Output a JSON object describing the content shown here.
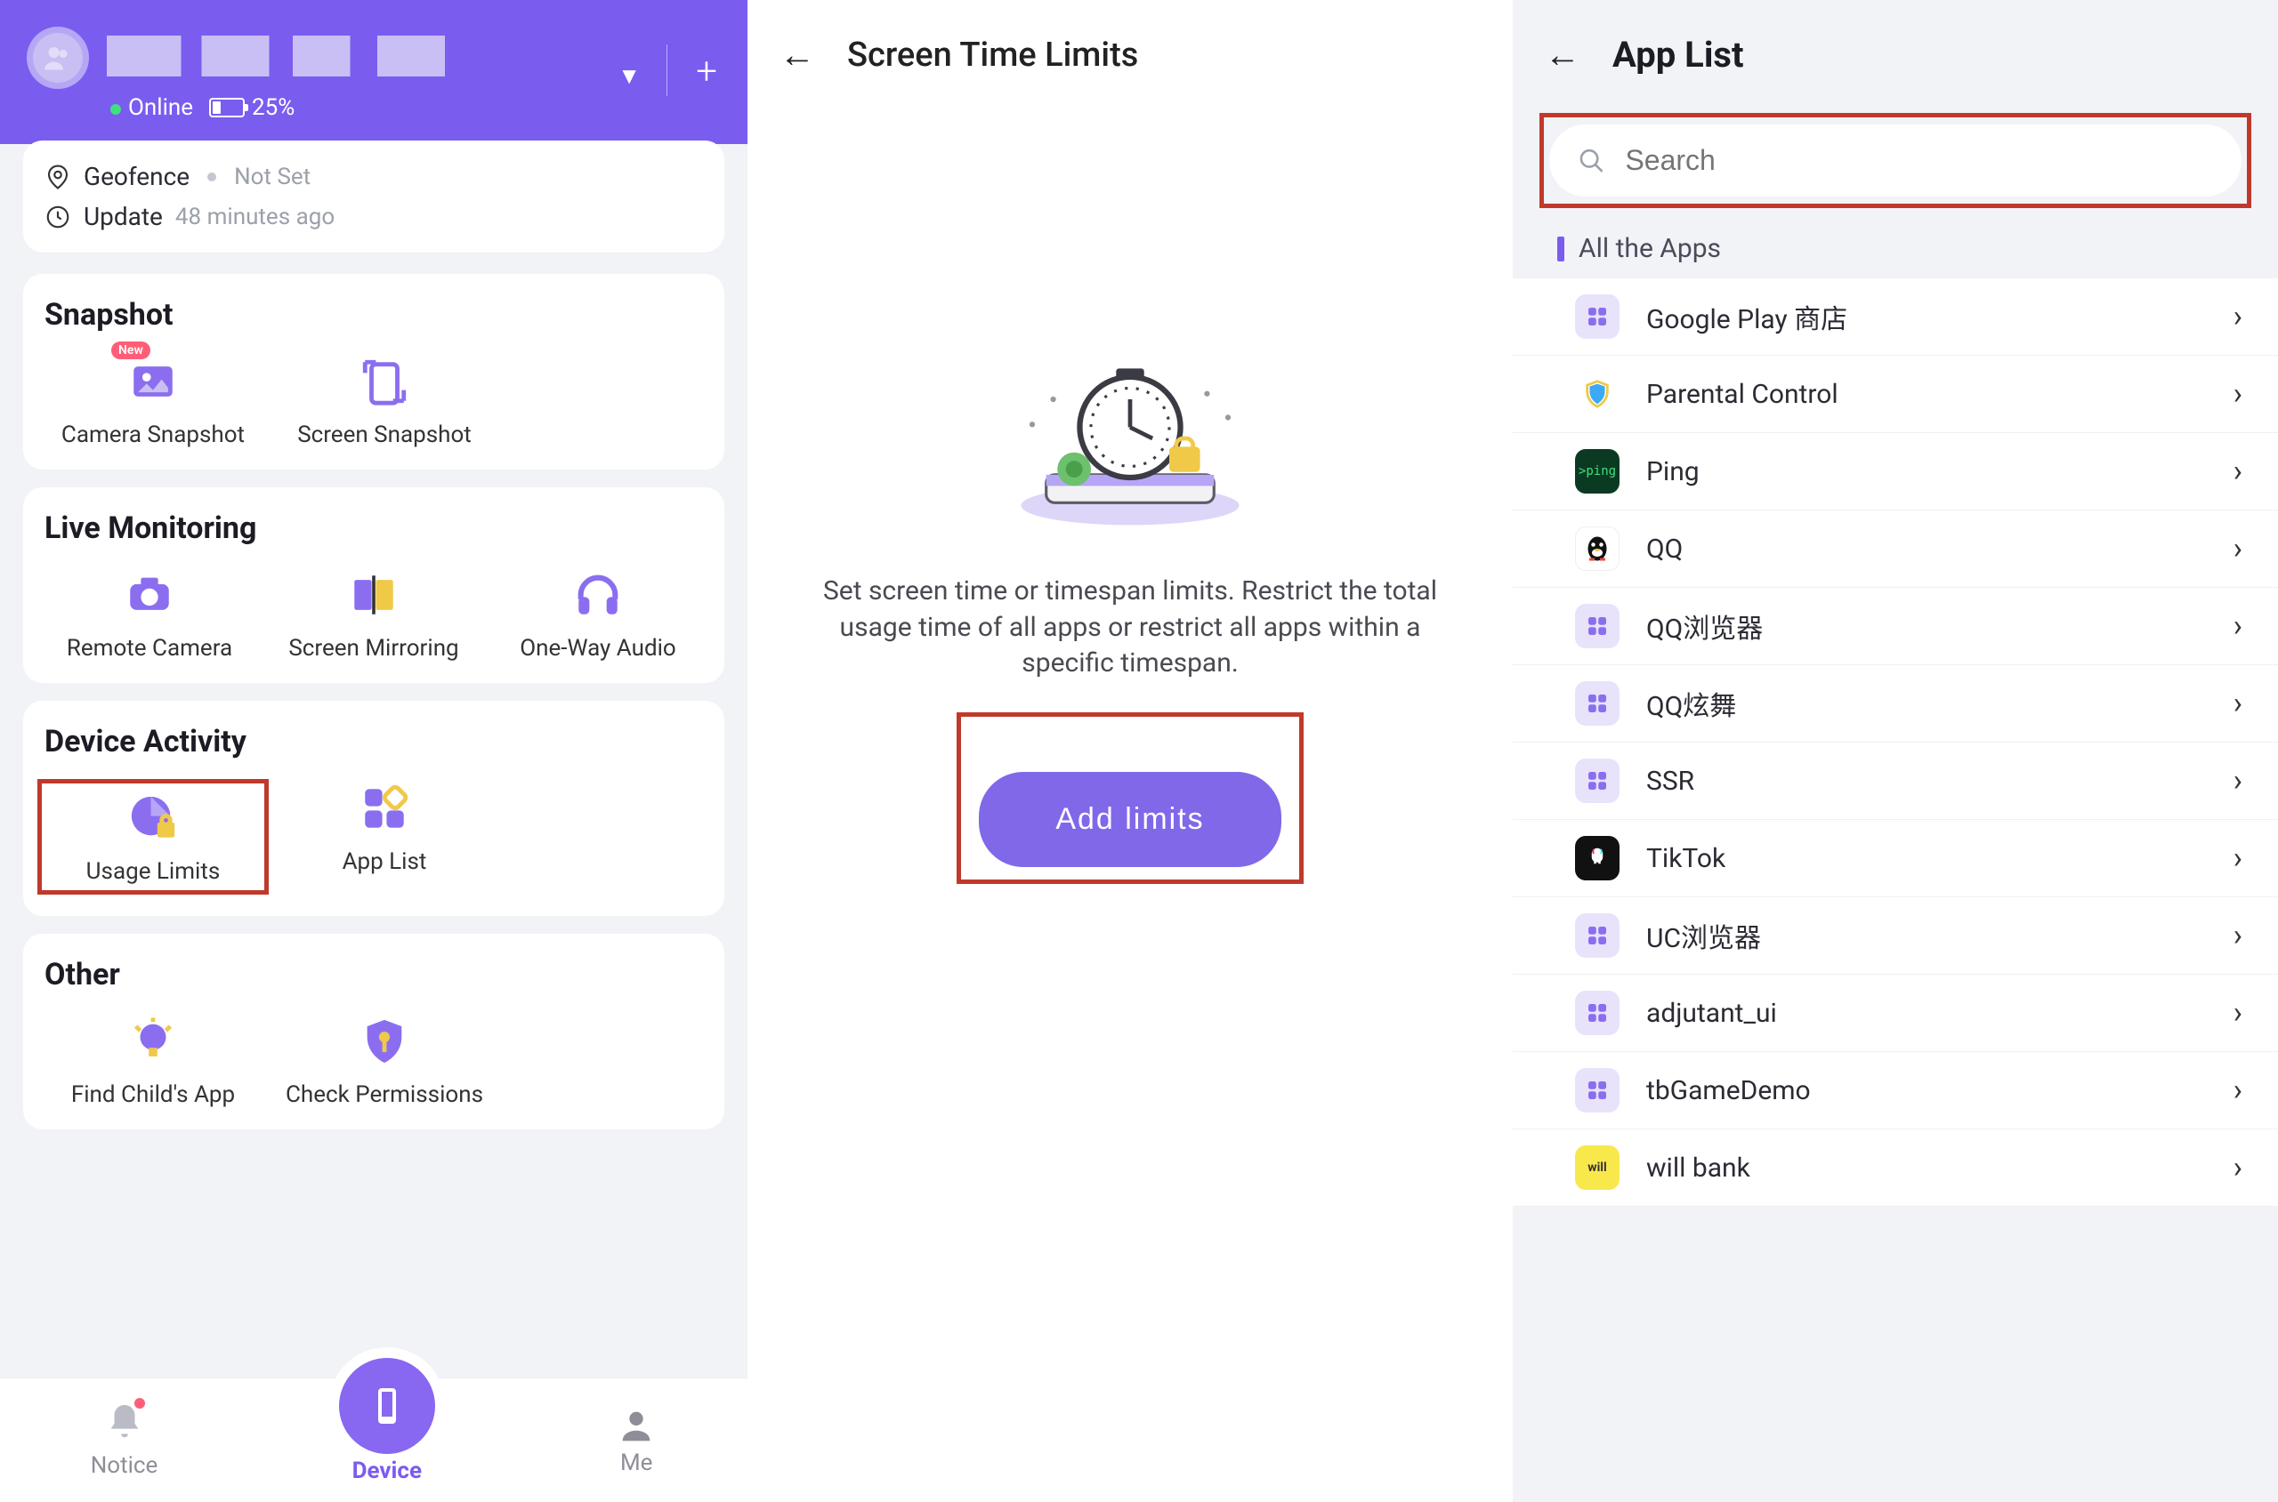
{
  "accent": "#7a5cef",
  "panel1": {
    "status_online": "Online",
    "battery_pct": "25%",
    "geofence_label": "Geofence",
    "geofence_value": "Not Set",
    "update_label": "Update",
    "update_value": "48 minutes ago",
    "snapshot": {
      "title": "Snapshot",
      "camera": "Camera Snapshot",
      "screen": "Screen Snapshot",
      "new_badge": "New"
    },
    "live": {
      "title": "Live Monitoring",
      "remote_camera": "Remote Camera",
      "screen_mirroring": "Screen Mirroring",
      "one_way_audio": "One-Way Audio"
    },
    "activity": {
      "title": "Device Activity",
      "usage_limits": "Usage Limits",
      "app_list": "App List"
    },
    "other": {
      "title": "Other",
      "find_child_app": "Find Child's App",
      "check_permissions": "Check Permissions"
    },
    "nav": {
      "notice": "Notice",
      "device": "Device",
      "me": "Me"
    }
  },
  "panel2": {
    "title": "Screen Time Limits",
    "description": "Set screen time or timespan limits. Restrict the total usage time of all apps or restrict all apps within a specific timespan.",
    "add_button": "Add limits"
  },
  "panel3": {
    "title": "App List",
    "search_placeholder": "Search",
    "filter_label": "All the Apps",
    "apps": [
      {
        "name": "Google Play 商店",
        "icon": "default"
      },
      {
        "name": "Parental Control",
        "icon": "shield"
      },
      {
        "name": "Ping",
        "icon": "ping"
      },
      {
        "name": "QQ",
        "icon": "qq"
      },
      {
        "name": "QQ浏览器",
        "icon": "default"
      },
      {
        "name": "QQ炫舞",
        "icon": "default"
      },
      {
        "name": "SSR",
        "icon": "default"
      },
      {
        "name": "TikTok",
        "icon": "dark"
      },
      {
        "name": "UC浏览器",
        "icon": "default"
      },
      {
        "name": "adjutant_ui",
        "icon": "default"
      },
      {
        "name": "tbGameDemo",
        "icon": "default"
      },
      {
        "name": "will bank",
        "icon": "will"
      }
    ]
  }
}
